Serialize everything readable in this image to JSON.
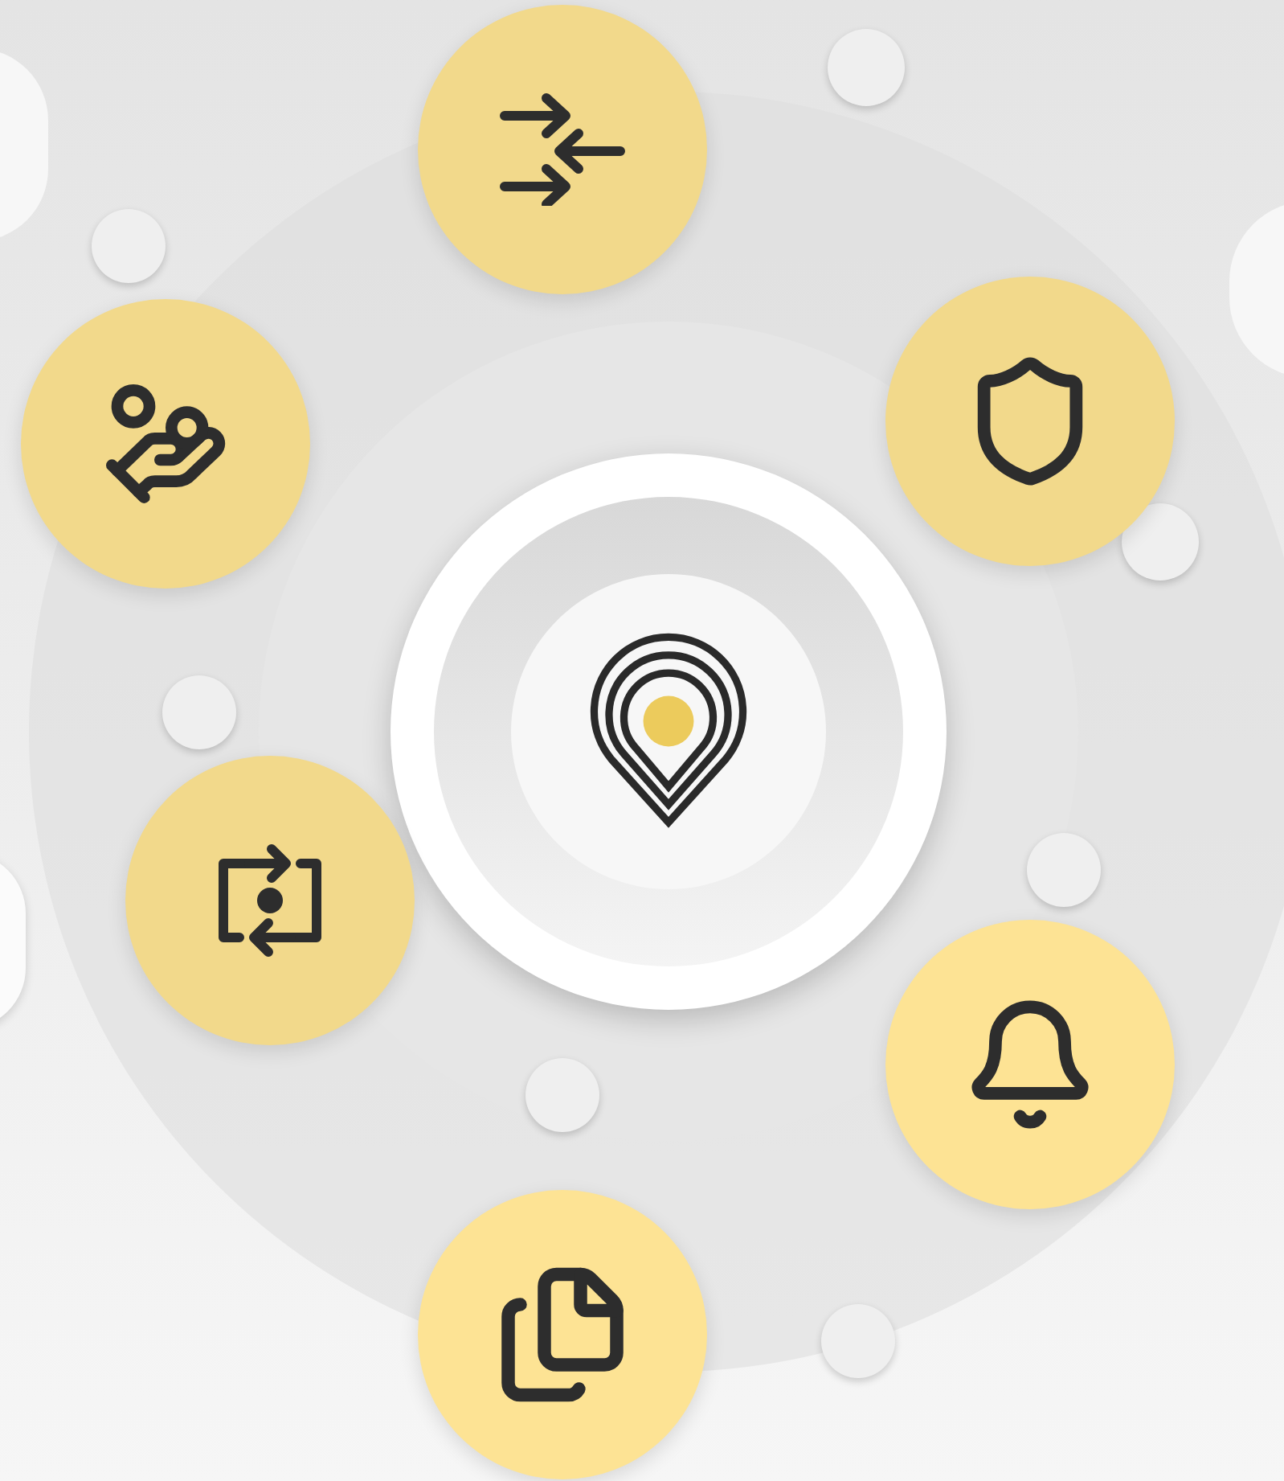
{
  "nodes": [
    {
      "kind": "merge",
      "color": "#f2d98b"
    },
    {
      "kind": "shield",
      "color": "#f2d98b"
    },
    {
      "kind": "hand",
      "color": "#f2d98b"
    },
    {
      "kind": "swap",
      "color": "#f2d98b"
    },
    {
      "kind": "bell",
      "color": "#fde394"
    },
    {
      "kind": "files",
      "color": "#fde394"
    }
  ],
  "center": {
    "kind": "pin",
    "color": "#eccb5c"
  }
}
